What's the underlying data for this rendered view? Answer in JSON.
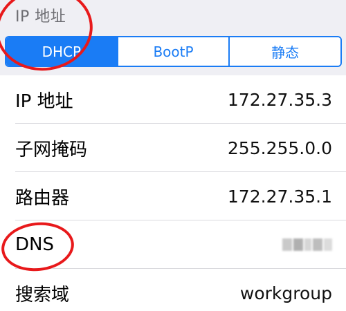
{
  "header": {
    "title": "IP 地址"
  },
  "segmented_control": {
    "options": [
      "DHCP",
      "BootP",
      "静态"
    ],
    "selected": "DHCP"
  },
  "rows": [
    {
      "label": "IP 地址",
      "value": "172.27.35.3"
    },
    {
      "label": "子网掩码",
      "value": "255.255.0.0"
    },
    {
      "label": "路由器",
      "value": "172.27.35.1"
    },
    {
      "label": "DNS",
      "value": ""
    },
    {
      "label": "搜索域",
      "value": "workgroup"
    }
  ],
  "colors": {
    "accent": "#1a7cf5",
    "annotation": "#e8191b",
    "background": "#efeff4"
  }
}
